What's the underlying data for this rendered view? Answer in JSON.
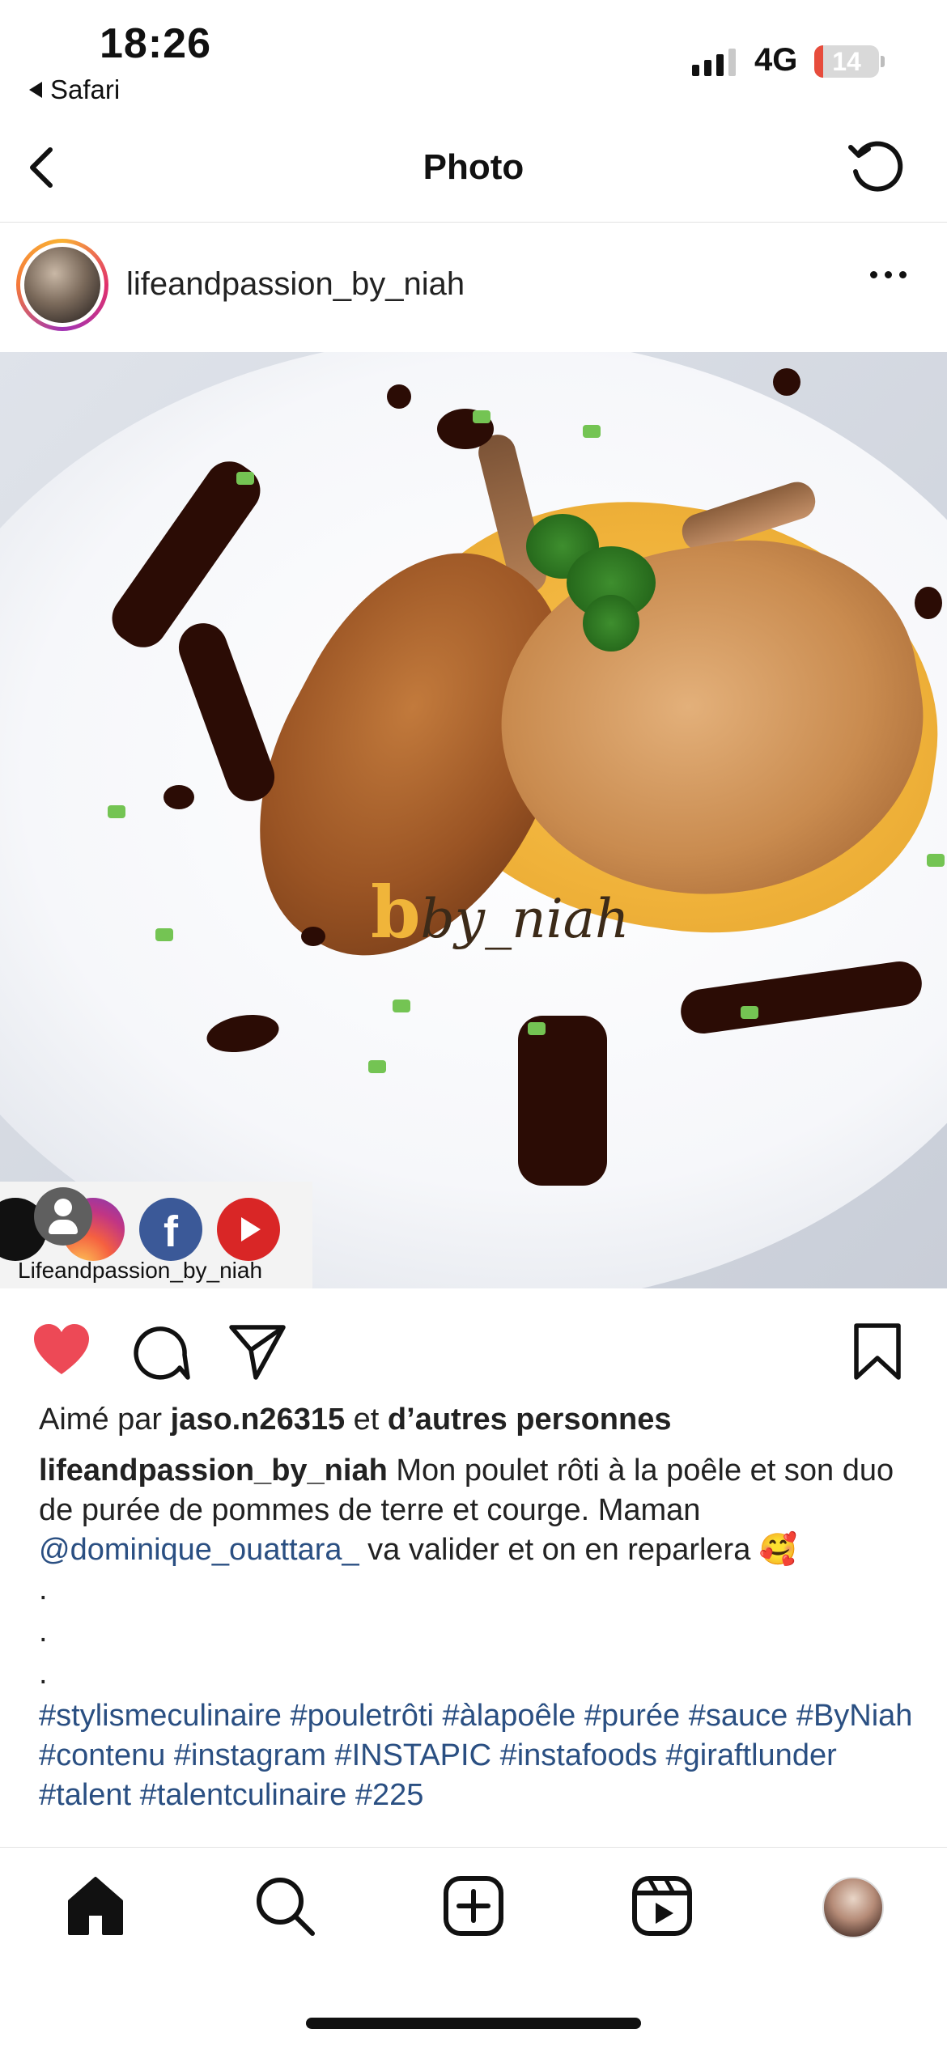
{
  "status_bar": {
    "time": "18:26",
    "back_app": "Safari",
    "network": "4G",
    "battery_level": "14",
    "battery_fraction": 0.14,
    "battery_color": "#e74c3c"
  },
  "nav": {
    "title": "Photo"
  },
  "post": {
    "username": "lifeandpassion_by_niah",
    "photo": {
      "watermark": "by_niah",
      "social_label": "Lifeandpassion_by_niah"
    },
    "actions": {
      "liked": true,
      "like_color": "#ed4956"
    },
    "likes": {
      "prefix": "Aimé par ",
      "user": "jaso.n26315",
      "middle": " et ",
      "others": "d’autres personnes"
    },
    "caption": {
      "user": "lifeandpassion_by_niah",
      "text1": " Mon poulet rôti à la poêle et son duo de purée de pommes de terre et courge. Maman ",
      "mention": "@dominique_ouattara_",
      "text2": " va valider et on en reparlera 🥰",
      "dots": [
        ".",
        ".",
        "."
      ],
      "hashtags": "#stylismeculinaire #pouletrôti #àlapoêle #purée #sauce #ByNiah #contenu #instagram #INSTAPIC #instafoods #giraftlunder #talent #talentculinaire #225",
      "link_color": "#2a4f82"
    }
  },
  "tabbar": {
    "items": [
      "home-icon",
      "search-icon",
      "create-post-icon",
      "reels-icon",
      "profile-avatar"
    ]
  }
}
